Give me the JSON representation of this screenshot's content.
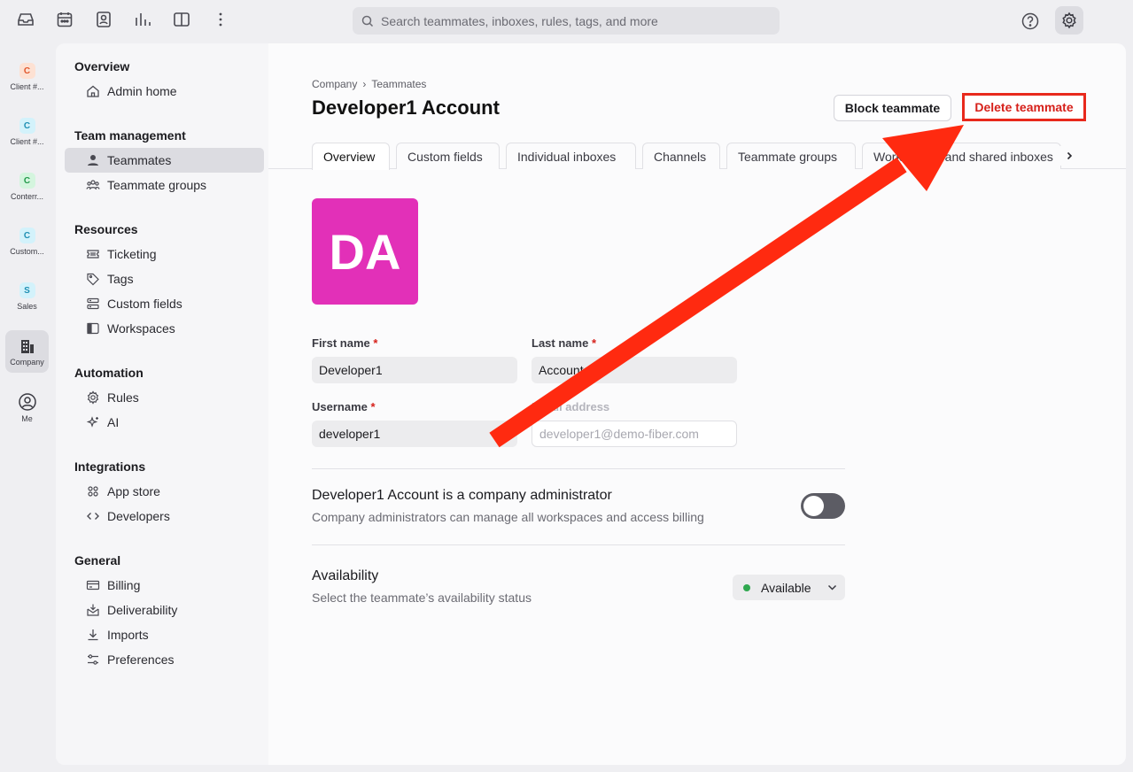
{
  "search": {
    "placeholder": "Search teammates, inboxes, rules, tags, and more"
  },
  "rail": [
    {
      "badge": "C",
      "label": "Client #...",
      "bg": "#fde1d3",
      "fg": "#e0552a"
    },
    {
      "badge": "C",
      "label": "Client #...",
      "bg": "#d3f2fb",
      "fg": "#1f8fb3"
    },
    {
      "badge": "C",
      "label": "Conterr...",
      "bg": "#d4f5de",
      "fg": "#22994a"
    },
    {
      "badge": "C",
      "label": "Custom...",
      "bg": "#d3f2fb",
      "fg": "#1f8fb3"
    },
    {
      "badge": "S",
      "label": "Sales",
      "bg": "#d3f2fb",
      "fg": "#1f8fb3"
    },
    {
      "label": "Company"
    },
    {
      "label": "Me"
    }
  ],
  "sidebar": {
    "overview": {
      "title": "Overview",
      "items": [
        "Admin home"
      ]
    },
    "team": {
      "title": "Team management",
      "items": [
        "Teammates",
        "Teammate groups"
      ]
    },
    "resources": {
      "title": "Resources",
      "items": [
        "Ticketing",
        "Tags",
        "Custom fields",
        "Workspaces"
      ]
    },
    "automation": {
      "title": "Automation",
      "items": [
        "Rules",
        "AI"
      ]
    },
    "integrations": {
      "title": "Integrations",
      "items": [
        "App store",
        "Developers"
      ]
    },
    "general": {
      "title": "General",
      "items": [
        "Billing",
        "Deliverability",
        "Imports",
        "Preferences"
      ]
    }
  },
  "breadcrumb": {
    "root": "Company",
    "sep": "›",
    "current": "Teammates"
  },
  "page": {
    "title": "Developer1 Account"
  },
  "actions": {
    "block": "Block teammate",
    "delete": "Delete teammate"
  },
  "tabs": [
    "Overview",
    "Custom fields",
    "Individual inboxes",
    "Channels",
    "Teammate groups",
    "Workspaces and shared inboxes"
  ],
  "avatar": {
    "initials": "DA",
    "color": "#e230b8"
  },
  "form": {
    "first_name": {
      "label": "First name",
      "value": "Developer1"
    },
    "last_name": {
      "label": "Last name",
      "value": "Account"
    },
    "username": {
      "label": "Username",
      "value": "developer1"
    },
    "email": {
      "label": "Email address",
      "value": "developer1@demo-fiber.com"
    },
    "required_mark": "*"
  },
  "admin": {
    "title": "Developer1 Account is a company administrator",
    "subtitle": "Company administrators can manage all workspaces and access billing",
    "enabled": false
  },
  "availability": {
    "title": "Availability",
    "subtitle": "Select the teammate’s availability status",
    "value": "Available"
  },
  "annotation": {
    "color": "#ff2a10"
  }
}
